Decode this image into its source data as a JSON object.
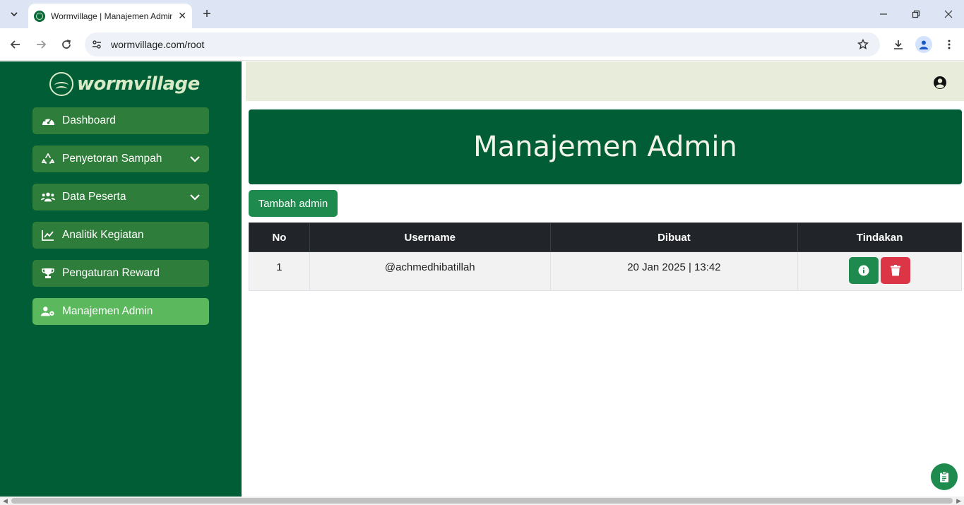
{
  "browser": {
    "tab_title": "Wormvillage | Manajemen Admin",
    "url": "wormvillage.com/root"
  },
  "sidebar": {
    "logo_text": "wormvillage",
    "items": [
      {
        "label": "Dashboard",
        "icon": "gauge-icon",
        "expandable": false,
        "active": false
      },
      {
        "label": "Penyetoran Sampah",
        "icon": "recycle-icon",
        "expandable": true,
        "active": false
      },
      {
        "label": "Data Peserta",
        "icon": "users-icon",
        "expandable": true,
        "active": false
      },
      {
        "label": "Analitik Kegiatan",
        "icon": "line-chart-icon",
        "expandable": false,
        "active": false
      },
      {
        "label": "Pengaturan Reward",
        "icon": "trophy-icon",
        "expandable": false,
        "active": false
      },
      {
        "label": "Manajemen Admin",
        "icon": "user-gear-icon",
        "expandable": false,
        "active": true
      }
    ]
  },
  "main": {
    "title": "Manajemen Admin",
    "add_button": "Tambah admin",
    "table": {
      "headers": [
        "No",
        "Username",
        "Dibuat",
        "Tindakan"
      ],
      "rows": [
        {
          "no": "1",
          "username": "@achmedhibatillah",
          "created": "20 Jan 2025 | 13:42"
        }
      ]
    }
  },
  "colors": {
    "sidebar_bg": "#015d36",
    "menu_item_bg": "#2f7d3a",
    "menu_item_active_bg": "#5bb85d",
    "topbar_bg": "#e8ecda",
    "primary_button": "#1e8a4e",
    "danger_button": "#dc3545",
    "table_header_bg": "#212529"
  }
}
